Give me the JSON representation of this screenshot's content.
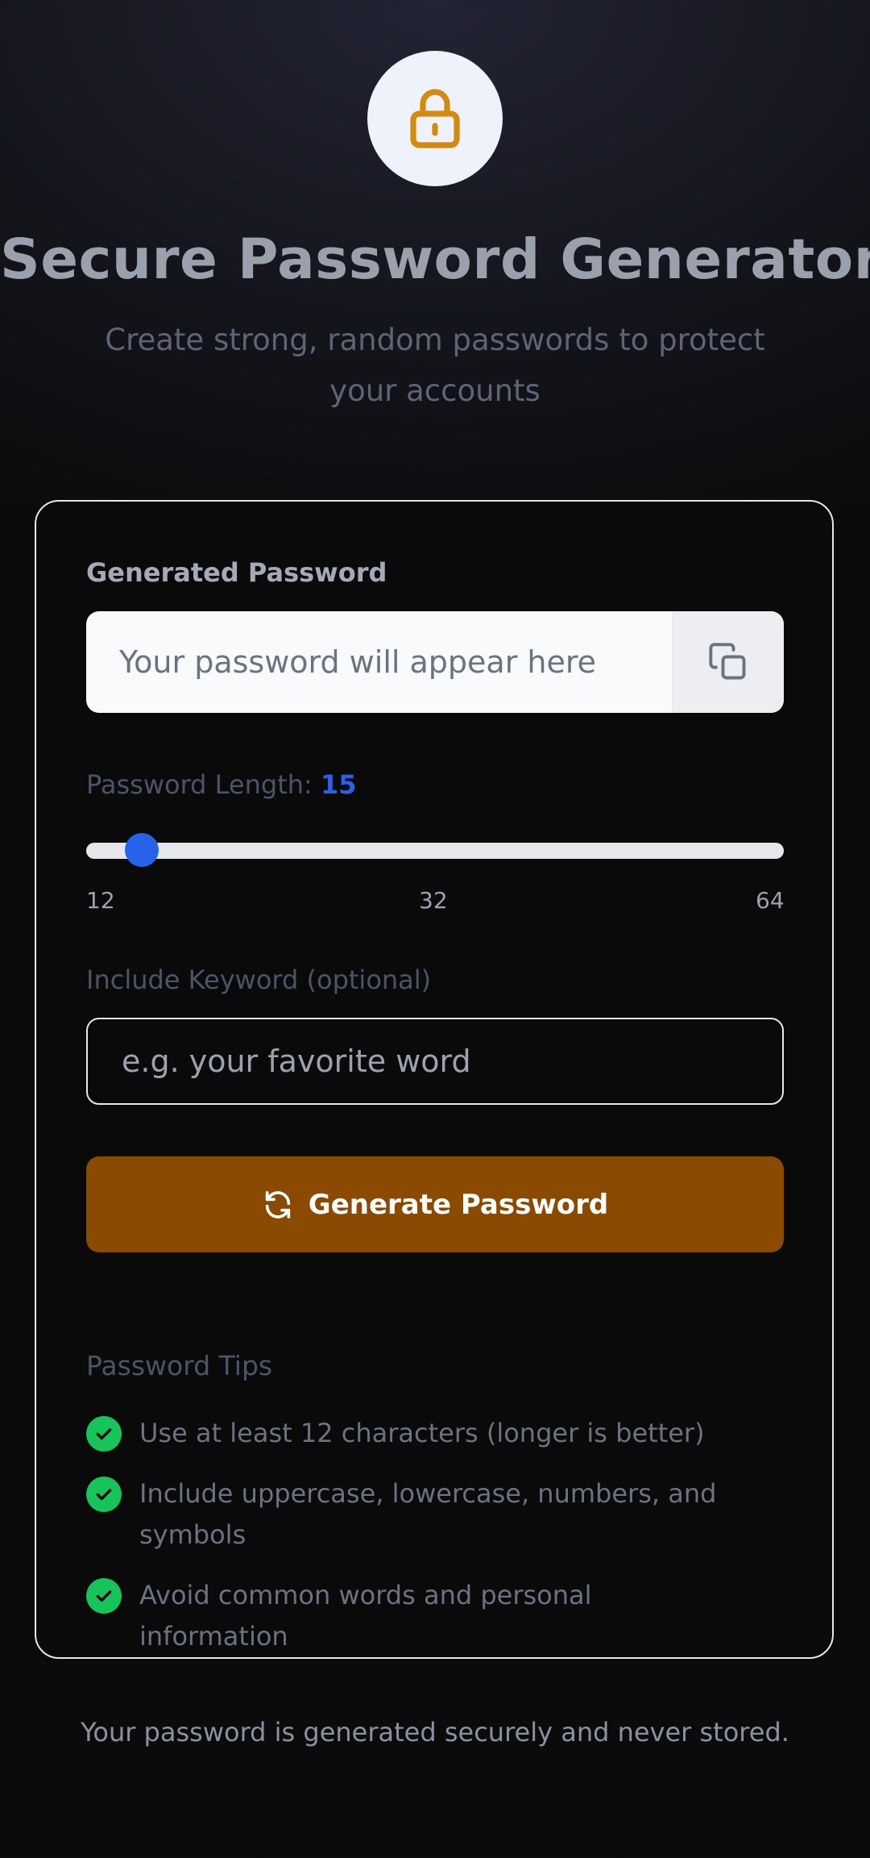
{
  "header": {
    "icon": "lock-icon",
    "title": "Secure Password Generator",
    "subtitle": "Create strong, random passwords to protect your accounts"
  },
  "generator": {
    "password_label": "Generated Password",
    "password_placeholder": "Your password will appear here",
    "copy_icon": "copy-icon",
    "length_label": "Password Length:",
    "length_value": "15",
    "length_fraction": 0.058,
    "length_ticks": [
      "12",
      "32",
      "64"
    ],
    "keyword_label": "Include Keyword (optional)",
    "keyword_placeholder": "e.g. your favorite word",
    "keyword_value": "",
    "generate_icon": "refresh-icon",
    "generate_label": "Generate Password"
  },
  "tips": {
    "title": "Password Tips",
    "check_icon": "check-circle-icon",
    "items": [
      "Use at least 12 characters (longer is better)",
      "Include uppercase, lowercase, numbers, and symbols",
      "Avoid common words and personal information"
    ]
  },
  "footer": {
    "note": "Your password is generated securely and never stored."
  },
  "colors": {
    "accent_amber": "#d48a0b",
    "slider_blue": "#2563eb",
    "generate_button": "#8a4a02",
    "check_green": "#16c55a"
  }
}
